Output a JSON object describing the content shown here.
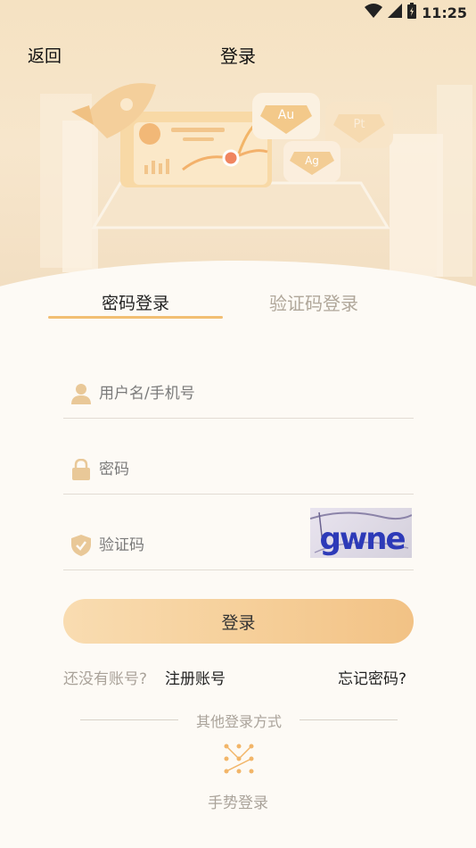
{
  "status_bar": {
    "time": "11:25"
  },
  "nav": {
    "back_label": "返回",
    "title": "登录"
  },
  "illustration": {
    "coin_au": "Au",
    "coin_pt": "Pt",
    "coin_ag": "Ag"
  },
  "tabs": [
    {
      "label": "密码登录",
      "active": true
    },
    {
      "label": "验证码登录",
      "active": false
    }
  ],
  "form": {
    "username_placeholder": "用户名/手机号",
    "password_placeholder": "密码",
    "captcha_placeholder": "验证码",
    "captcha_text": "gwne"
  },
  "login_button": "登录",
  "links": {
    "no_account": "还没有账号?",
    "register": "注册账号",
    "forgot": "忘记密码?"
  },
  "other_login": {
    "title": "其他登录方式",
    "gesture_label": "手势登录"
  },
  "colors": {
    "accent": "#f2bf73",
    "button_start": "#f9dcb1",
    "button_end": "#f2c285"
  }
}
